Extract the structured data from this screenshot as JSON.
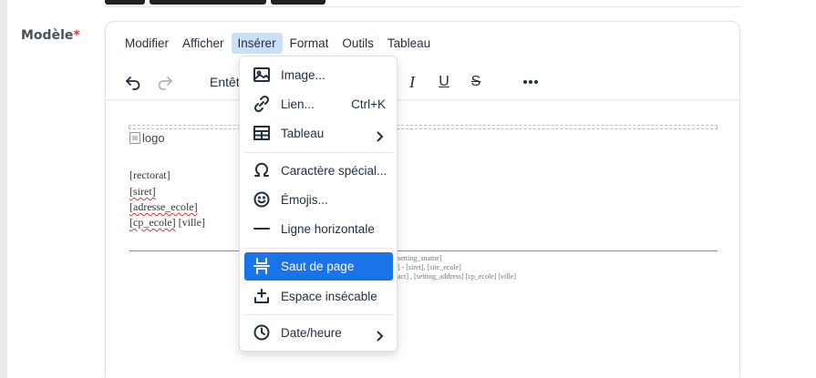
{
  "field": {
    "label": "Modèle",
    "required_mark": "*"
  },
  "menubar": {
    "items": [
      {
        "label": "Modifier"
      },
      {
        "label": "Afficher"
      },
      {
        "label": "Insérer",
        "active": true
      },
      {
        "label": "Format"
      },
      {
        "label": "Outils"
      },
      {
        "label": "Tableau"
      }
    ]
  },
  "toolbar": {
    "undo_icon": "undo-icon",
    "redo_icon": "redo-icon",
    "block_format_label": "Entêt",
    "italic_glyph": "I",
    "underline_glyph": "U",
    "strike_glyph": "S",
    "more_icon": "more-icon"
  },
  "content": {
    "logo_alt": "logo",
    "lines": [
      "[rectorat]",
      "[siret]",
      "[adresse_ecole]",
      "[cp_ecole]",
      "[ville]"
    ],
    "small_lines": [
      "setting_sname]",
      "] - [siret], [site_ecole]",
      "act] , [setting_address] [cp_ecole] [ville]"
    ]
  },
  "dropdown": {
    "items": [
      {
        "label": "Image...",
        "icon": "image-icon"
      },
      {
        "label": "Lien...",
        "shortcut": "Ctrl+K",
        "icon": "link-icon"
      },
      {
        "label": "Tableau",
        "icon": "table-icon",
        "submenu": true
      },
      {
        "label": "Caractère spécial...",
        "icon": "omega-icon"
      },
      {
        "label": "Émojis...",
        "icon": "emoji-icon"
      },
      {
        "label": "Ligne horizontale",
        "icon": "horizontal-line-icon"
      },
      {
        "label": "Saut de page",
        "icon": "page-break-icon",
        "highlighted": true
      },
      {
        "label": "Espace insécable",
        "icon": "nonbreaking-space-icon"
      },
      {
        "label": "Date/heure",
        "icon": "clock-icon",
        "submenu": true
      }
    ]
  },
  "colors": {
    "accent": "#1a73e8",
    "menu_active": "#cce0f5",
    "required": "#dc3545"
  }
}
